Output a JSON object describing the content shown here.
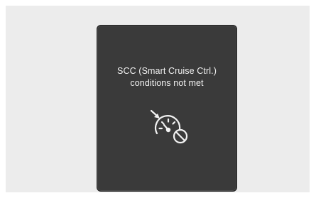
{
  "warning": {
    "line1": "SCC (Smart Cruise Ctrl.)",
    "line2": "conditions not met",
    "icon": "cruise-control-unavailable-icon"
  },
  "colors": {
    "display_background": "#3a3a3a",
    "text": "#f2f2f2",
    "frame_background": "#ececec"
  }
}
